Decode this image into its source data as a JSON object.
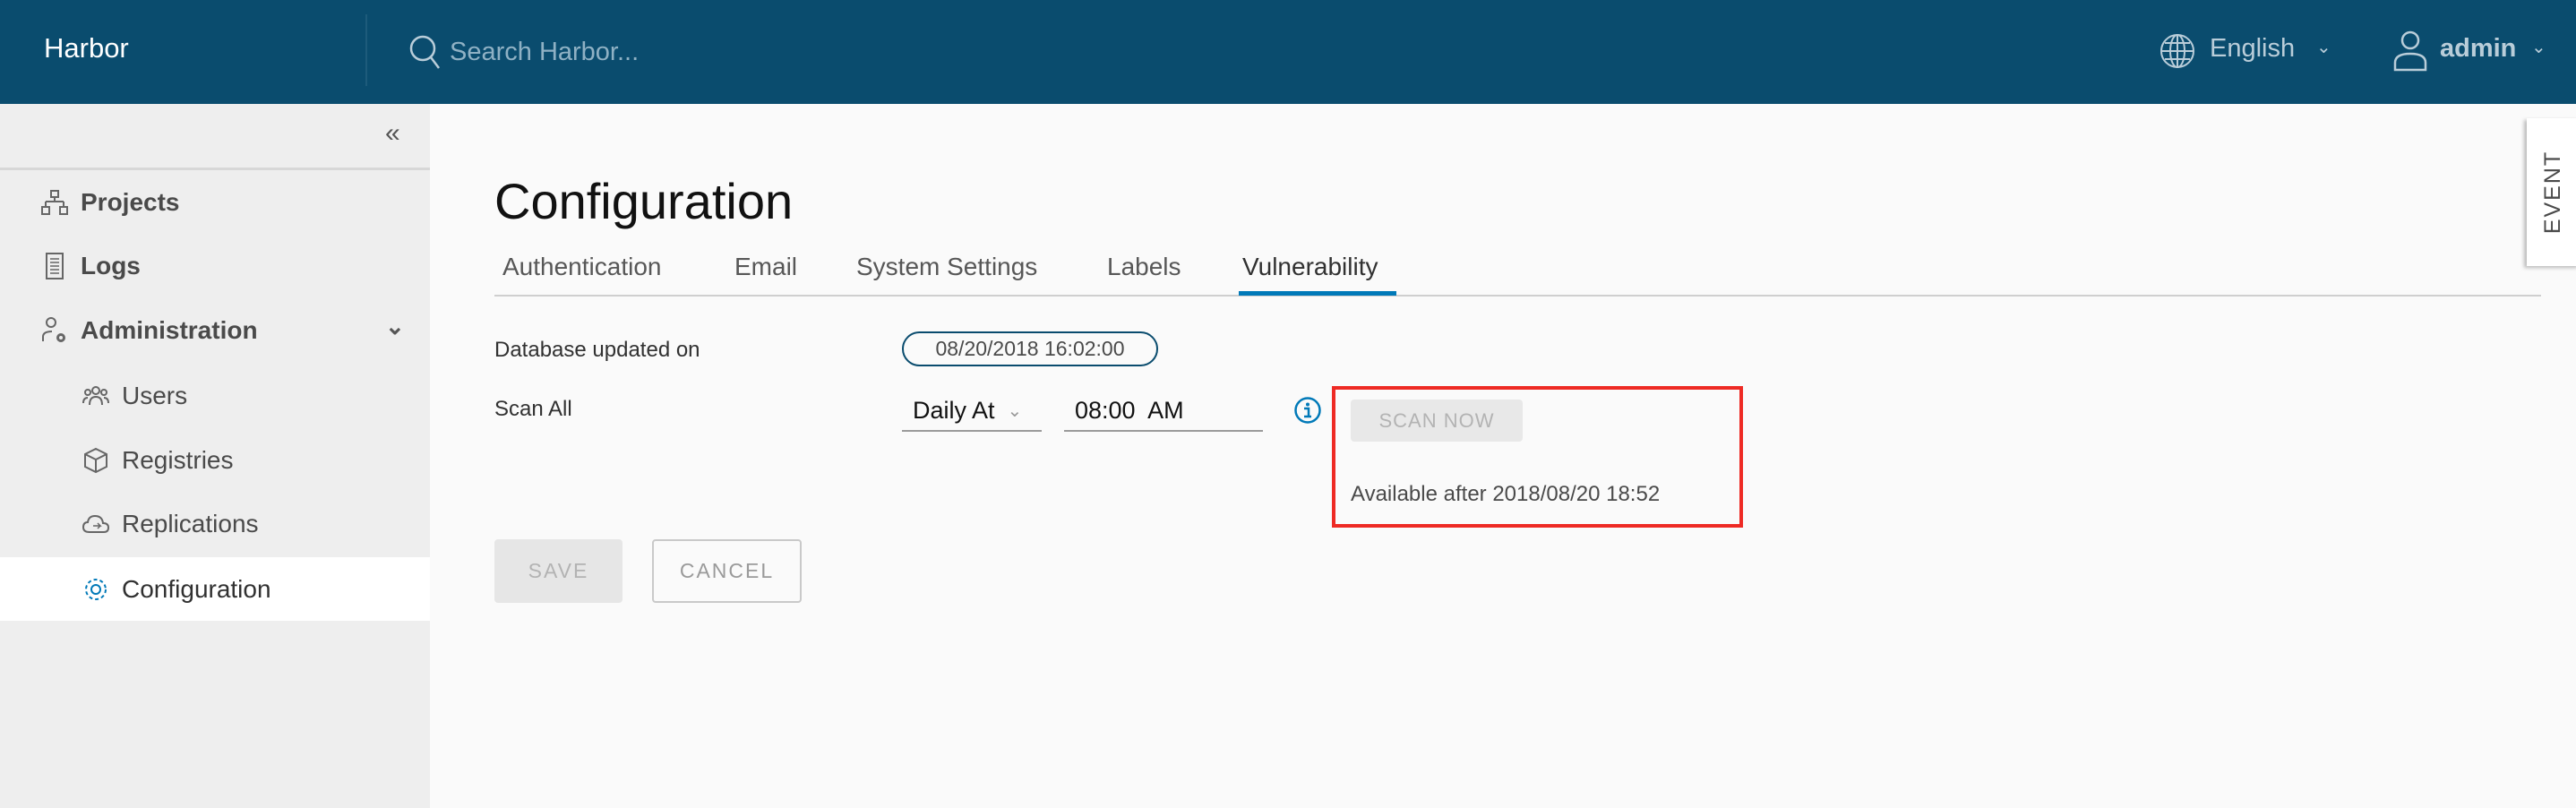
{
  "header": {
    "brand": "Harbor",
    "search_placeholder": "Search Harbor...",
    "language": "English",
    "user": "admin",
    "bg_color": "#0a4c6e"
  },
  "sidebar": {
    "items": [
      {
        "label": "Projects",
        "icon": "projects-icon"
      },
      {
        "label": "Logs",
        "icon": "logs-icon"
      },
      {
        "label": "Administration",
        "icon": "administration-icon",
        "expanded": true
      },
      {
        "label": "Users",
        "icon": "users-icon"
      },
      {
        "label": "Registries",
        "icon": "registries-icon"
      },
      {
        "label": "Replications",
        "icon": "replications-icon"
      },
      {
        "label": "Configuration",
        "icon": "gear-icon",
        "active": true
      }
    ]
  },
  "main": {
    "title": "Configuration",
    "tabs": [
      {
        "label": "Authentication"
      },
      {
        "label": "Email"
      },
      {
        "label": "System Settings"
      },
      {
        "label": "Labels"
      },
      {
        "label": "Vulnerability",
        "active": true
      }
    ],
    "db_label": "Database updated on",
    "db_value": "08/20/2018 16:02:00",
    "scan_all_label": "Scan All",
    "schedule": "Daily At",
    "time": "08:00  AM",
    "scan_now": "SCAN NOW",
    "available": "Available after 2018/08/20 18:52",
    "save": "SAVE",
    "cancel": "CANCEL",
    "accent": "#0079b8",
    "highlight_color": "#ee2a24"
  },
  "event_tab": "EVENT"
}
